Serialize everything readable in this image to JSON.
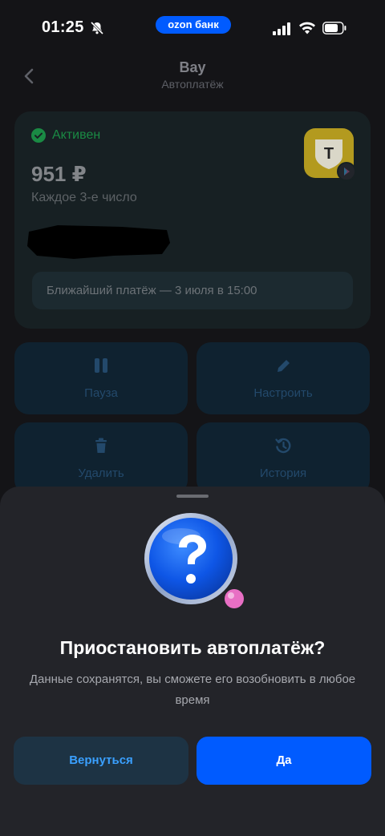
{
  "status_bar": {
    "time": "01:25",
    "carrier_pill": "ozon банк",
    "icons": [
      "bell-slash-icon",
      "cellular-signal-icon",
      "wifi-icon",
      "battery-icon"
    ]
  },
  "header": {
    "title": "Bay",
    "subtitle": "Автоплатёж"
  },
  "card": {
    "status_label": "Активен",
    "amount": "951 ₽",
    "schedule": "Каждое 3-е число",
    "next_payment": "Ближайший платёж — 3 июля в 15:00",
    "logo_letter": "Т"
  },
  "actions": [
    {
      "label": "Пауза",
      "icon": "pause-icon"
    },
    {
      "label": "Настроить",
      "icon": "pencil-icon"
    },
    {
      "label": "Удалить",
      "icon": "trash-icon"
    },
    {
      "label": "История",
      "icon": "history-icon"
    }
  ],
  "sheet": {
    "icon": "question-icon",
    "title": "Приостановить автоплатёж?",
    "description": "Данные сохранятся, вы сможете его возобновить в любое время",
    "back_label": "Вернуться",
    "confirm_label": "Да"
  },
  "colors": {
    "accent": "#005bff",
    "status_ok": "#1a8a44",
    "sheet_bg": "#232429"
  }
}
